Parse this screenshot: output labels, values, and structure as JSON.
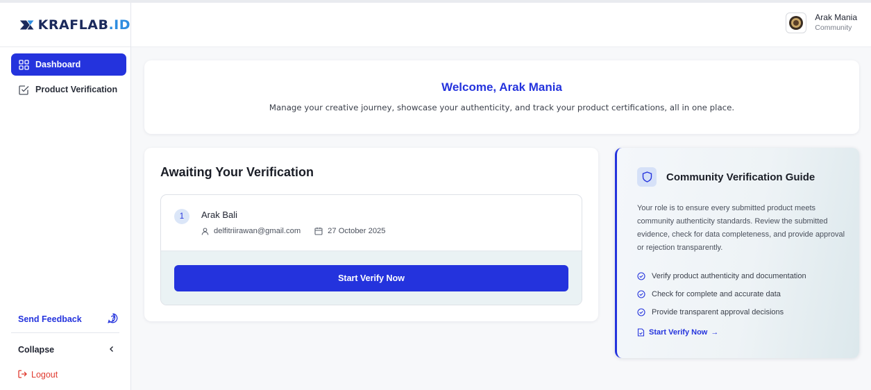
{
  "brand": {
    "logo_text_main": "KRAFLAB",
    "logo_text_suffix": ".ID"
  },
  "sidebar": {
    "items": [
      {
        "label": "Dashboard",
        "icon": "grid-icon",
        "active": true
      },
      {
        "label": "Product Verification",
        "icon": "checkbox-icon",
        "active": false
      }
    ],
    "feedback_label": "Send Feedback",
    "collapse_label": "Collapse",
    "logout_label": "Logout"
  },
  "header": {
    "user_name": "Arak Mania",
    "user_role": "Community"
  },
  "welcome": {
    "title": "Welcome, Arak Mania",
    "subtitle": "Manage your creative journey, showcase your authenticity, and track your product certifications, all in one place."
  },
  "awaiting": {
    "title": "Awaiting Your Verification",
    "items": [
      {
        "index": "1",
        "name": "Arak Bali",
        "email": "delfitriirawan@gmail.com",
        "date": "27 October 2025"
      }
    ],
    "button_label": "Start Verify Now"
  },
  "guide": {
    "title": "Community Verification Guide",
    "description": "Your role is to ensure every submitted product meets community authenticity standards. Review the submitted evidence, check for data completeness, and provide approval or rejection transparently.",
    "points": [
      "Verify product authenticity and documentation",
      "Check for complete and accurate data",
      "Provide transparent approval decisions"
    ],
    "link_label": "Start Verify Now",
    "link_arrow": "→"
  },
  "colors": {
    "accent": "#2433dd",
    "logout": "#e03a2f",
    "logo_dark": "#1b2a5c",
    "logo_light": "#2f8de0"
  }
}
